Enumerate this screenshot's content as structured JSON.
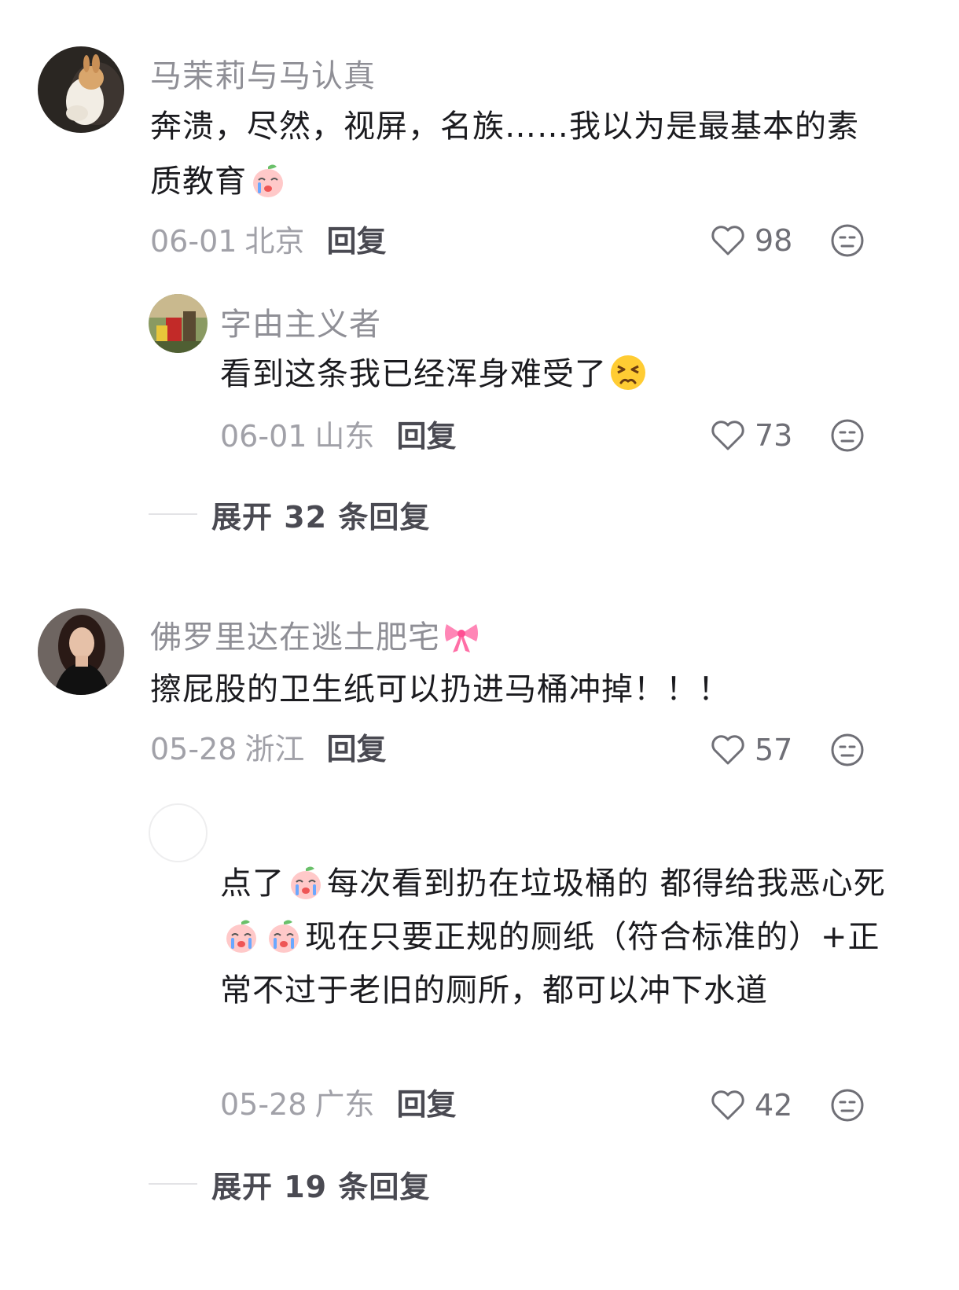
{
  "comments": [
    {
      "username": "马茉莉与马认真",
      "text_parts": [
        "奔溃，尽然，视屏，名族……我以为是最基本的素质教育"
      ],
      "time": "06-01",
      "location": "北京",
      "reply_label": "回复",
      "likes": "98",
      "replies": [
        {
          "username": "字由主义者",
          "text": "看到这条我已经浑身难受了",
          "time": "06-01",
          "location": "山东",
          "reply_label": "回复",
          "likes": "73"
        }
      ],
      "expand_label": "展开 32 条回复"
    },
    {
      "username": "佛罗里达在逃土肥宅",
      "text": "擦屁股的卫生纸可以扔进马桶冲掉！！！",
      "time": "05-28",
      "location": "浙江",
      "reply_label": "回复",
      "likes": "57",
      "replies": [
        {
          "username": "",
          "text_a": "点了",
          "text_b": "每次看到扔在垃圾桶的 都得给我恶心死",
          "text_c": "现在只要正规的厕纸（符合标准的）+正常不过于老旧的厕所，都可以冲下水道",
          "time": "05-28",
          "location": "广东",
          "reply_label": "回复",
          "likes": "42"
        }
      ],
      "expand_label": "展开 19 条回复"
    }
  ],
  "icons": {
    "like": "heart-outline-icon",
    "more": "neutral-face-icon",
    "emoji_sad": "crying-peach-emoji",
    "emoji_persevere": "persevering-face-emoji",
    "emoji_bow": "pink-bow-emoji"
  },
  "colors": {
    "username": "#8f8f96",
    "content": "#1b1b1f",
    "meta": "#a1a1a8",
    "reply": "#4a4a52"
  }
}
